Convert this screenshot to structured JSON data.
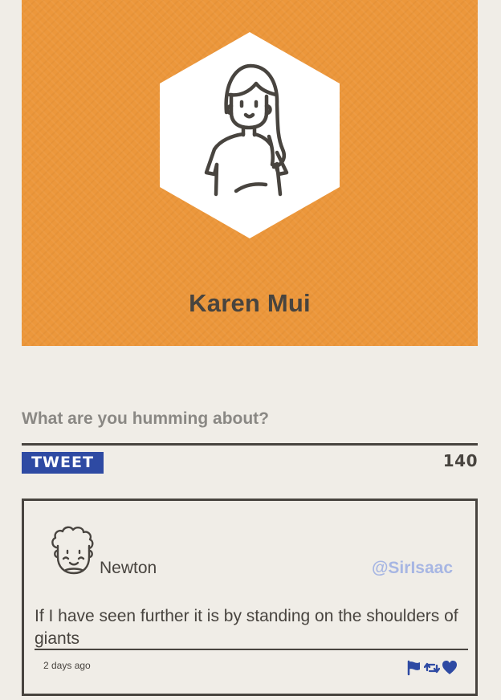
{
  "profile": {
    "name": "Karen Mui",
    "avatar_icon": "woman-avatar-icon",
    "card_color": "#ec973b"
  },
  "compose": {
    "placeholder": "What are you humming about?",
    "value": "",
    "button_label": "TWEET",
    "char_count": "140"
  },
  "tweet": {
    "avatar_icon": "man-curly-hair-avatar-icon",
    "author": "Newton",
    "handle": "@SirIsaac",
    "text": "If I have seen further it is by standing on the shoulders of giants",
    "time": "2 days ago",
    "actions": {
      "flag_icon": "flag-icon",
      "retweet_icon": "retweet-icon",
      "like_icon": "heart-icon"
    }
  },
  "colors": {
    "background": "#f0ede7",
    "accent_blue": "#2e4aa3",
    "handle_blue": "#a7b6e3",
    "text_dark": "#48443f"
  }
}
